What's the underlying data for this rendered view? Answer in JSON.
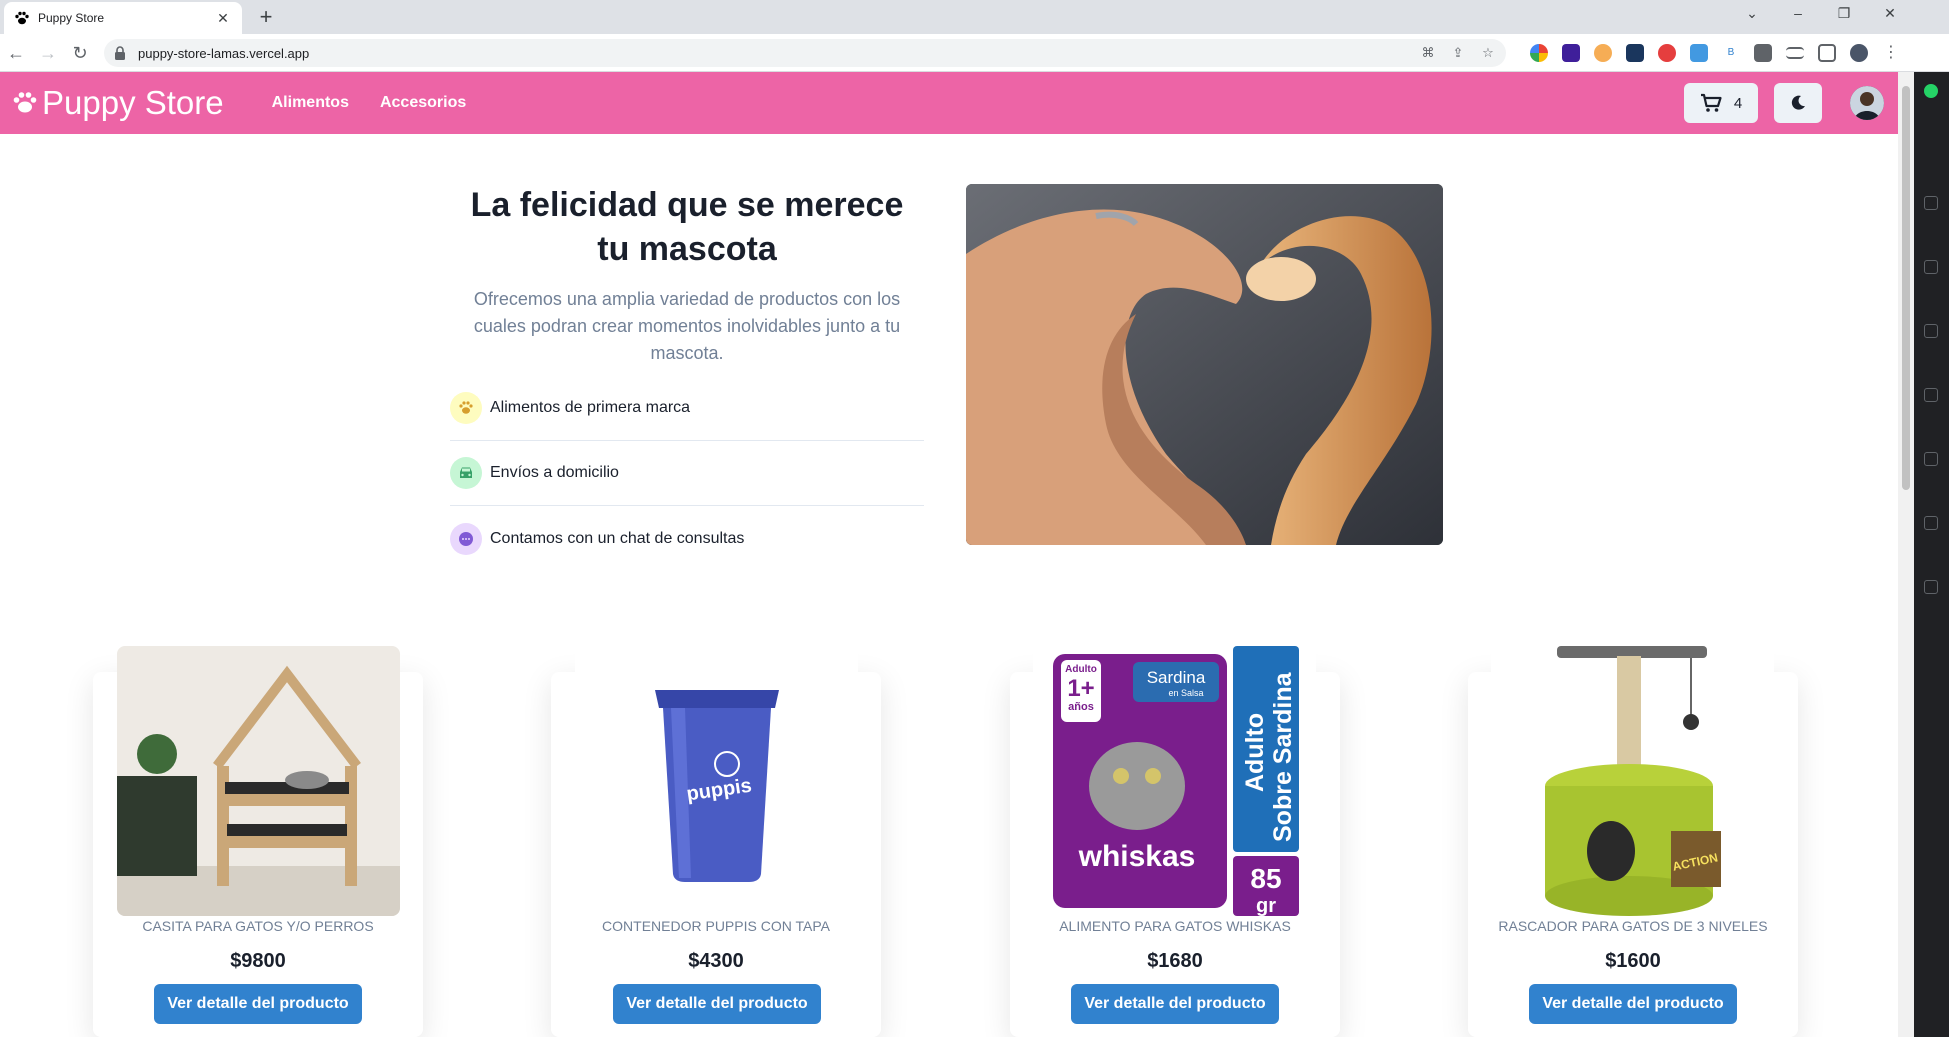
{
  "browser": {
    "tab_title": "Puppy Store",
    "url": "puppy-store-lamas.vercel.app",
    "new_tab_symbol": "+",
    "close_symbol": "✕"
  },
  "site": {
    "brand": "Puppy Store",
    "nav_links": [
      "Alimentos",
      "Accesorios"
    ],
    "cart_count": "4",
    "brand_color": "#ed64a6"
  },
  "hero": {
    "title": "La felicidad que se merece tu mascota",
    "subtitle": "Ofrecemos una amplia variedad de productos con los cuales podran crear momentos inolvidables junto a tu mascota.",
    "features": [
      {
        "label": "Alimentos de primera marca",
        "icon": "paw-icon",
        "color": "#fefcbf"
      },
      {
        "label": "Envíos a domicilio",
        "icon": "car-icon",
        "color": "#c6f6d5"
      },
      {
        "label": "Contamos con un chat de consultas",
        "icon": "chat-icon",
        "color": "#e9d8fd"
      }
    ]
  },
  "products": [
    {
      "name": "CASITA PARA GATOS Y/O PERROS",
      "price": "$9800",
      "button": "Ver detalle del producto"
    },
    {
      "name": "CONTENEDOR PUPPIS CON TAPA",
      "price": "$4300",
      "button": "Ver detalle del producto"
    },
    {
      "name": "ALIMENTO PARA GATOS WHISKAS",
      "price": "$1680",
      "button": "Ver detalle del producto"
    },
    {
      "name": "RASCADOR PARA GATOS DE 3 NIVELES",
      "price": "$1600",
      "button": "Ver detalle del producto"
    }
  ],
  "product_image_text": {
    "bin_logo": "puppis",
    "whiskas_brand": "whiskas",
    "whiskas_flavor": "Sardina",
    "whiskas_sauce": "en Salsa",
    "whiskas_age_top": "Adulto",
    "whiskas_age": "1+",
    "whiskas_age_unit": "años",
    "whiskas_side_1": "Adulto",
    "whiskas_side_2": "Sobre Sardina",
    "whiskas_weight": "85",
    "whiskas_weight_unit": "gr",
    "scratcher_tag": "ACTION"
  }
}
